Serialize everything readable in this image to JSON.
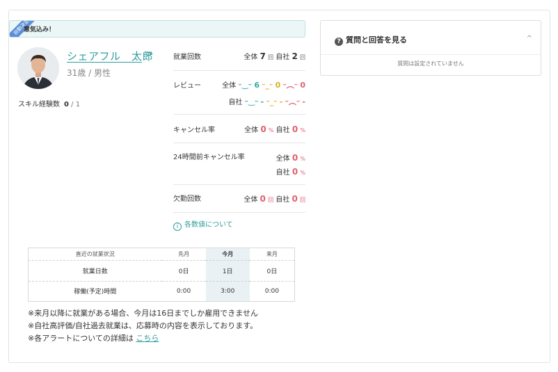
{
  "banner": {
    "ribbon": "自動決定",
    "text": "意気込み！"
  },
  "profile": {
    "name": "シェアフル　太郎",
    "chevron": ">",
    "age_gender": "31歳 / 男性",
    "skill_label": "スキル経験数",
    "skill_count": "0",
    "skill_total": "/ 1"
  },
  "stats": {
    "work_count": {
      "label": "就業回数",
      "all_label": "全体",
      "all": "7",
      "unit": "回",
      "own_label": "自社",
      "own": "2"
    },
    "review": {
      "label": "レビュー",
      "all_label": "全体",
      "good": "6",
      "neutral": "0",
      "bad": "0",
      "own_label": "自社",
      "own_good": "-",
      "own_neutral": "-",
      "own_bad": "-",
      "face_good": "ᵕ‿ᵕ",
      "face_neutral": "ᵕ_ᵕ",
      "face_bad": "ᵕ︵ᵕ"
    },
    "cancel_rate": {
      "label": "キャンセル率",
      "all_label": "全体",
      "all": "0",
      "unit": "%",
      "own_label": "自社",
      "own": "0"
    },
    "cancel_24h": {
      "label": "24時間前キャンセル率",
      "all_label": "全体",
      "all": "0",
      "unit": "%",
      "own_label": "自社",
      "own": "0"
    },
    "absence": {
      "label": "欠勤回数",
      "all_label": "全体",
      "all": "0",
      "unit": "回",
      "own_label": "自社",
      "own": "0"
    },
    "about_link": "各数値について"
  },
  "work_table": {
    "headers": [
      "直近の就業状況",
      "先月",
      "今月",
      "来月"
    ],
    "rows": [
      {
        "label": "就業日数",
        "values": [
          "0日",
          "1日",
          "0日"
        ]
      },
      {
        "label": "稼働(予定)時間",
        "values": [
          "0:00",
          "3:00",
          "0:00"
        ]
      }
    ]
  },
  "notes": {
    "line1": "※来月以降に就業がある場合、今月は16日までしか雇用できません",
    "line2": "※自社高評価/自社過去就業は、応募時の内容を表示しております。",
    "line3_prefix": "※各アラートについての詳細は",
    "line3_link": "こちら"
  },
  "qa": {
    "title": "質問と回答を見る",
    "icon": "?",
    "chevron": "^",
    "empty": "質問は設定されていません"
  }
}
